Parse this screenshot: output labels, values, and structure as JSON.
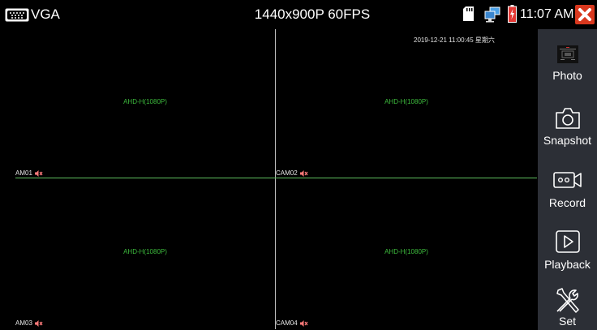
{
  "status": {
    "source_label": "VGA",
    "resolution": "1440x900P 60FPS",
    "time": "11:07 AM"
  },
  "cameras": [
    {
      "name": "AM01",
      "format": "AHD-H(1080P)"
    },
    {
      "name": "CAM02",
      "format": "AHD-H(1080P)"
    },
    {
      "name": "AM03",
      "format": "AHD-H(1080P)"
    },
    {
      "name": "CAM04",
      "format": "AHD-H(1080P)"
    }
  ],
  "overlay": {
    "datetime": "2019-12-21 11:00:45 星期六"
  },
  "menu": {
    "photo": "Photo",
    "snapshot": "Snapshot",
    "record": "Record",
    "playback": "Playback",
    "set": "Set"
  },
  "colors": {
    "sidebar": "#2c2f36",
    "close": "#d9381e",
    "format_text": "#3dbb3d",
    "divider_green": "#5fbf5f"
  },
  "icons": [
    "vga-port-icon",
    "sd-card-icon",
    "network-icon",
    "battery-icon",
    "close-icon",
    "mute-speaker-icon",
    "photo-thumbnail-icon",
    "camera-icon",
    "video-camera-icon",
    "play-icon",
    "tools-icon"
  ]
}
